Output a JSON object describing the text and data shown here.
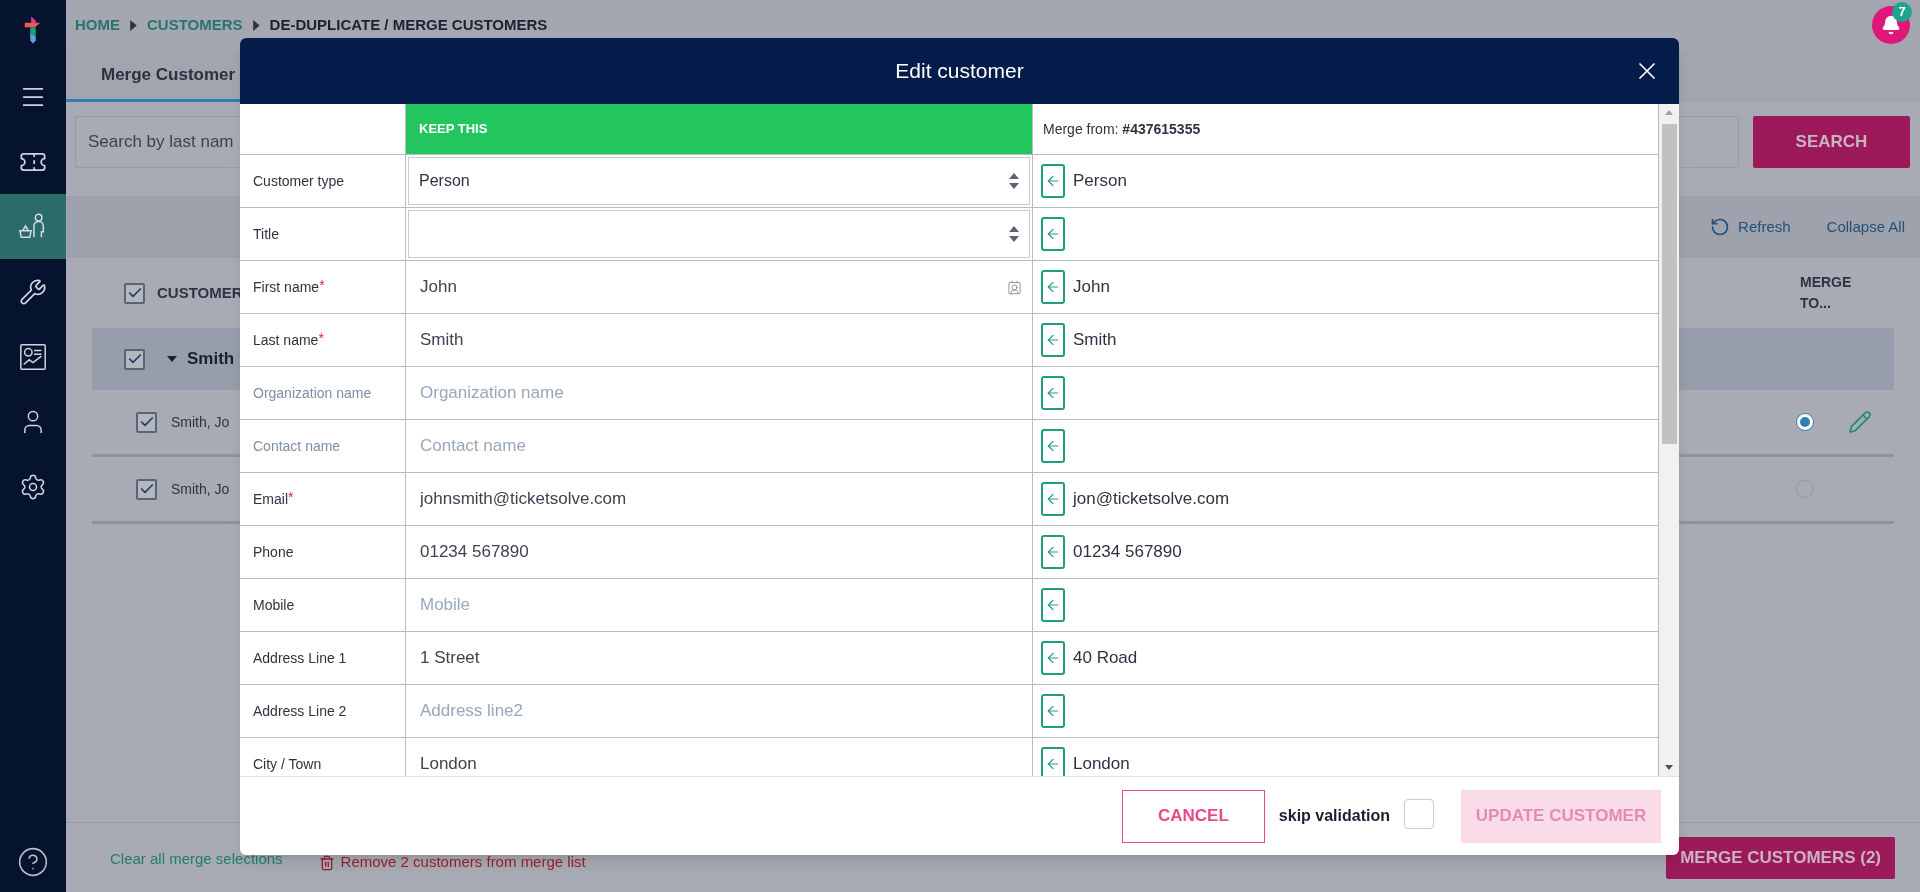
{
  "sidebar": {
    "items": [
      {
        "kind": "menu",
        "selected": false
      },
      {
        "kind": "tickets",
        "selected": false
      },
      {
        "kind": "customers",
        "selected": true
      },
      {
        "kind": "tools",
        "selected": false
      },
      {
        "kind": "reports",
        "selected": false
      },
      {
        "kind": "user",
        "selected": false
      },
      {
        "kind": "settings",
        "selected": false
      }
    ]
  },
  "breadcrumb": [
    {
      "label": "HOME",
      "current": false
    },
    {
      "label": "CUSTOMERS",
      "current": false
    },
    {
      "label": "DE-DUPLICATE / MERGE CUSTOMERS",
      "current": true
    }
  ],
  "notifications": {
    "count": "7"
  },
  "tabs": [
    {
      "label": "Merge Customer",
      "selected": true
    }
  ],
  "search": {
    "placeholder": "Search by last nam",
    "button": "SEARCH"
  },
  "toolbar": {
    "refresh": "Refresh",
    "collapse": "Collapse All"
  },
  "table": {
    "header": {
      "checked": true,
      "customer": "CUSTOMER",
      "merge_to": "MERGE TO..."
    },
    "group": {
      "checked": true,
      "expanded": true,
      "label": "Smith"
    },
    "rows": [
      {
        "checked": true,
        "name": "Smith, Jo",
        "selected": true,
        "editable": true
      },
      {
        "checked": true,
        "name": "Smith, Jo",
        "selected": false,
        "editable": false
      }
    ]
  },
  "footer": {
    "clear": "Clear all merge selections",
    "remove": "Remove 2 customers from merge list",
    "merge": "MERGE CUSTOMERS (2)"
  },
  "modal": {
    "title": "Edit customer",
    "keep_label": "KEEP THIS",
    "merge_from": "Merge from: **#437615355**",
    "fields": [
      {
        "label": "Customer type",
        "muted": false,
        "kind": "select",
        "value": "Person",
        "merge_value": "Person"
      },
      {
        "label": "Title",
        "muted": false,
        "kind": "select"
      },
      {
        "label": "First name",
        "required_mark": "*",
        "muted": false,
        "kind": "input_card",
        "value": "John",
        "merge_value": "John"
      },
      {
        "label": "Last name",
        "required_mark": "*",
        "muted": false,
        "kind": "input",
        "value": "Smith",
        "merge_value": "Smith"
      },
      {
        "label": "Organization name",
        "muted": true,
        "kind": "input",
        "placeholder": "Organization name"
      },
      {
        "label": "Contact name",
        "muted": true,
        "kind": "input",
        "placeholder": "Contact name"
      },
      {
        "label": "Email",
        "required_mark": "*",
        "muted": false,
        "kind": "input",
        "value": "johnsmith@ticketsolve.com",
        "merge_value": "jon@ticketsolve.com"
      },
      {
        "label": "Phone",
        "muted": false,
        "kind": "input",
        "value": "01234 567890",
        "merge_value": "01234 567890"
      },
      {
        "label": "Mobile",
        "muted": false,
        "kind": "input",
        "placeholder": "Mobile"
      },
      {
        "label": "Address Line 1",
        "muted": false,
        "kind": "input",
        "value": "1 Street",
        "merge_value": "40 Road"
      },
      {
        "label": "Address Line 2",
        "muted": false,
        "kind": "input",
        "placeholder": "Address line2"
      },
      {
        "label": "City / Town",
        "muted": false,
        "kind": "input",
        "value": "London",
        "merge_value": "London"
      }
    ],
    "cancel": "CANCEL",
    "skip_validation": {
      "label": "skip validation",
      "checked": false
    },
    "update": {
      "label": "UPDATE CUSTOMER",
      "disabled": true
    }
  }
}
